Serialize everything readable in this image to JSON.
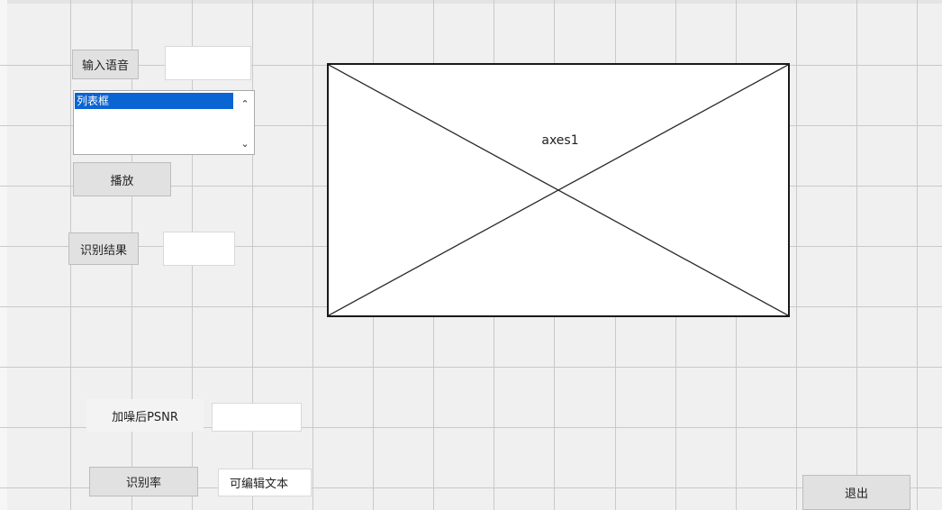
{
  "controls": {
    "input_voice_button": "输入语音",
    "listbox_item": "列表框",
    "scroll_up": "⌃",
    "scroll_down": "⌄",
    "play_button": "播放",
    "recognition_result_button": "识别结果",
    "noise_psnr_label": "加噪后PSNR",
    "recognition_rate_button": "识别率",
    "editable_text_value": "可编辑文本",
    "exit_button": "退出"
  },
  "axes": {
    "label": "axes1"
  },
  "colors": {
    "background": "#f0f0f0",
    "grid": "#c9c9c9",
    "listbox_highlight": "#0a64d2",
    "button_face": "#e1e1e1"
  }
}
